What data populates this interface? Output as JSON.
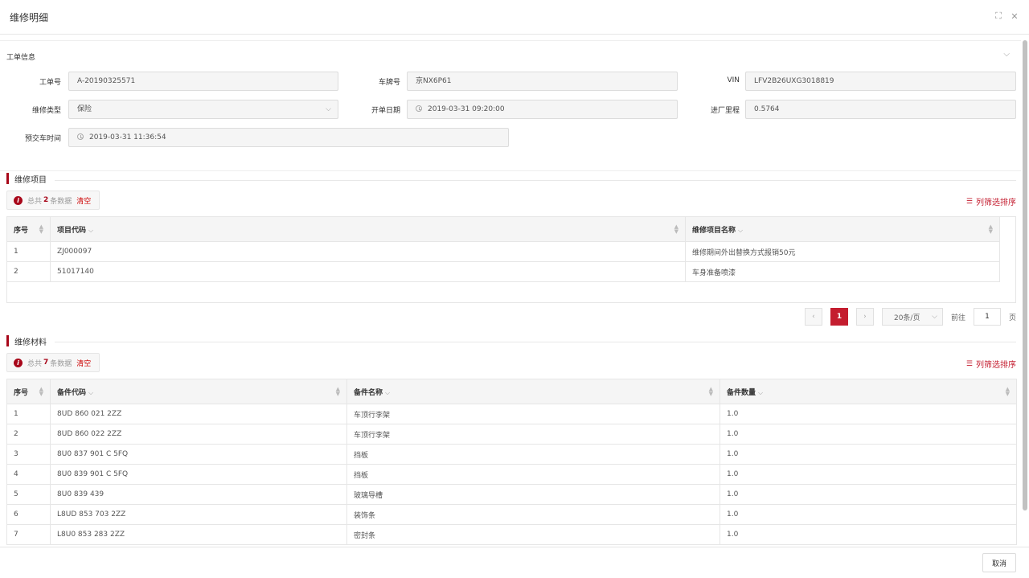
{
  "dialog": {
    "title": "维修明细",
    "cancel_label": "取消"
  },
  "work_order": {
    "title": "工单信息",
    "fields": {
      "order_no": {
        "label": "工单号",
        "value": "A-20190325571"
      },
      "plate_no": {
        "label": "车牌号",
        "value": "京NX6P61"
      },
      "vin": {
        "label": "VIN",
        "value": "LFV2B26UXG3018819"
      },
      "repair_type": {
        "label": "维修类型",
        "value": "保险"
      },
      "open_date": {
        "label": "开单日期",
        "value": "2019-03-31 09:20:00"
      },
      "mileage": {
        "label": "进厂里程",
        "value": "0.5764"
      },
      "delivery_time": {
        "label": "预交车时间",
        "value": "2019-03-31 11:36:54"
      }
    }
  },
  "repair_items": {
    "title": "维修项目",
    "alert": {
      "prefix": "总共",
      "count": "2",
      "suffix": "条数据",
      "clear": "清空"
    },
    "column_filter": "列筛选排序",
    "columns": [
      "序号",
      "项目代码",
      "维修项目名称"
    ],
    "rows": [
      [
        "1",
        "ZJ000097",
        "维修期间外出替换方式报销50元"
      ],
      [
        "2",
        "51017140",
        "车身准备喷漆"
      ]
    ],
    "pager": {
      "current_page": "1",
      "page_size": "20条/页",
      "goto_label": "前往",
      "goto_value": "1",
      "page_unit": "页"
    }
  },
  "materials": {
    "title": "维修材料",
    "alert": {
      "prefix": "总共",
      "count": "7",
      "suffix": "条数据",
      "clear": "清空"
    },
    "column_filter": "列筛选排序",
    "columns": [
      "序号",
      "备件代码",
      "备件名称",
      "备件数量"
    ],
    "rows": [
      [
        "1",
        "8UD 860 021 2ZZ",
        "车顶行李架",
        "1.0"
      ],
      [
        "2",
        "8UD 860 022 2ZZ",
        "车顶行李架",
        "1.0"
      ],
      [
        "3",
        "8U0 837 901 C 5FQ",
        "挡板",
        "1.0"
      ],
      [
        "4",
        "8U0 839 901 C 5FQ",
        "挡板",
        "1.0"
      ],
      [
        "5",
        "8U0 839 439",
        "玻璃导槽",
        "1.0"
      ],
      [
        "6",
        "L8UD 853 703 2ZZ",
        "装饰条",
        "1.0"
      ],
      [
        "7",
        "L8U0 853 283 2ZZ",
        "密封条",
        "1.0"
      ]
    ]
  },
  "colors": {
    "accent": "#a8071a",
    "link": "#c41d2f"
  }
}
